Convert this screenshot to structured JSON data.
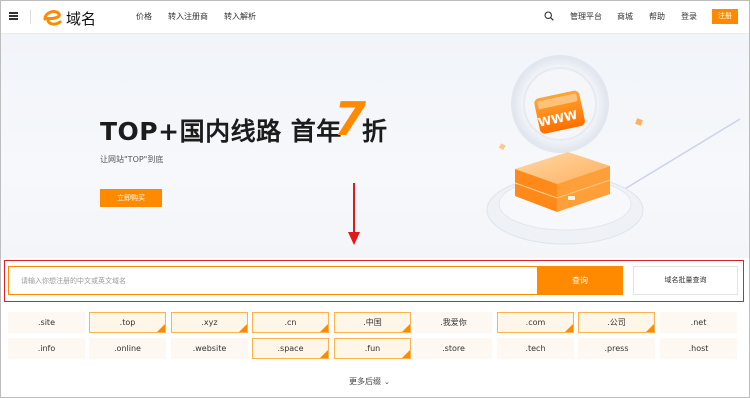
{
  "header": {
    "logo_text": "域名",
    "nav": [
      "价格",
      "转入注册商",
      "转入解析"
    ],
    "right_nav": [
      "管理平台",
      "商城",
      "帮助",
      "登录"
    ],
    "register_label": "注册"
  },
  "banner": {
    "title_left": "TOP+国内线路  首年",
    "title_number": "7",
    "title_right": "折",
    "subtitle": "让网站\"TOP\"到底",
    "buy_label": "立即购买",
    "badge_text": "WWW"
  },
  "search": {
    "placeholder": "请输入你想注册的中文或英文域名",
    "button_label": "查询",
    "batch_label": "域名批量查询"
  },
  "suffixes": [
    {
      "label": ".site",
      "hot": false
    },
    {
      "label": ".top",
      "hot": true
    },
    {
      "label": ".xyz",
      "hot": true
    },
    {
      "label": ".cn",
      "hot": true
    },
    {
      "label": ".中国",
      "hot": true
    },
    {
      "label": ".我爱你",
      "hot": false
    },
    {
      "label": ".com",
      "hot": true
    },
    {
      "label": ".公司",
      "hot": true
    },
    {
      "label": ".net",
      "hot": false
    },
    {
      "label": ".info",
      "hot": false
    },
    {
      "label": ".online",
      "hot": false
    },
    {
      "label": ".website",
      "hot": false
    },
    {
      "label": ".space",
      "hot": true
    },
    {
      "label": ".fun",
      "hot": true
    },
    {
      "label": ".store",
      "hot": false
    },
    {
      "label": ".tech",
      "hot": false
    },
    {
      "label": ".press",
      "hot": false
    },
    {
      "label": ".host",
      "hot": false
    }
  ],
  "more_label": "更多后缀",
  "colors": {
    "accent": "#ff8a00",
    "highlight_border": "#d9232d",
    "arrow": "#e01919"
  }
}
